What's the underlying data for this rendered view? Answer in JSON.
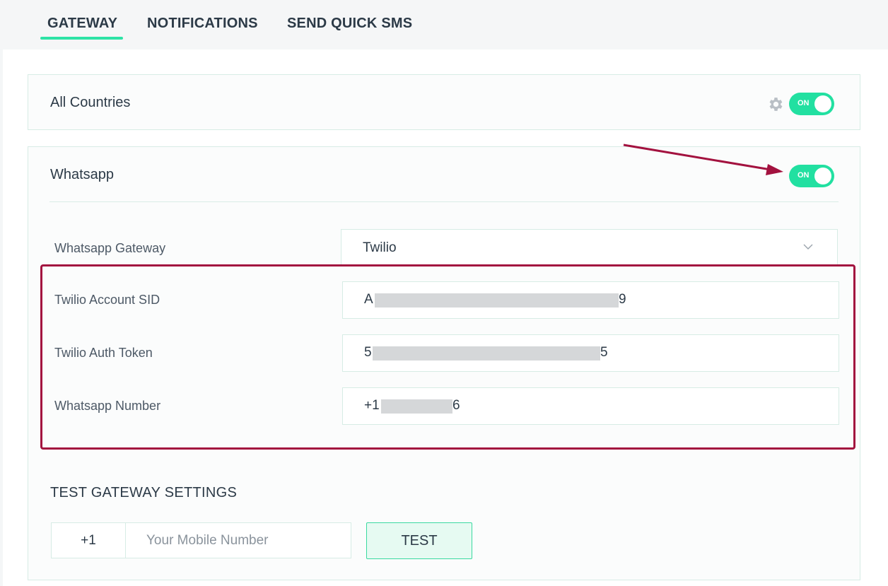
{
  "tabs": [
    {
      "label": "GATEWAY",
      "active": true
    },
    {
      "label": "NOTIFICATIONS",
      "active": false
    },
    {
      "label": "SEND QUICK SMS",
      "active": false
    }
  ],
  "all_countries": {
    "title": "All Countries",
    "toggle_label": "ON"
  },
  "whatsapp": {
    "title": "Whatsapp",
    "toggle_label": "ON",
    "gateway_label": "Whatsapp Gateway",
    "gateway_value": "Twilio",
    "account_sid_label": "Twilio Account SID",
    "account_sid_start": "A",
    "account_sid_end": "9",
    "auth_token_label": "Twilio Auth Token",
    "auth_token_start": "5",
    "auth_token_end": "5",
    "number_label": "Whatsapp Number",
    "number_start": "+1",
    "number_end": "6"
  },
  "test_gateway": {
    "heading": "TEST GATEWAY SETTINGS",
    "country_code": "+1",
    "mobile_placeholder": "Your Mobile Number",
    "test_label": "TEST"
  },
  "colors": {
    "accent": "#22e0a1",
    "annotation": "#a3123f",
    "border": "#d7ece5"
  },
  "icons": {
    "settings": "gear-icon",
    "dropdown": "chevron-down-icon"
  }
}
